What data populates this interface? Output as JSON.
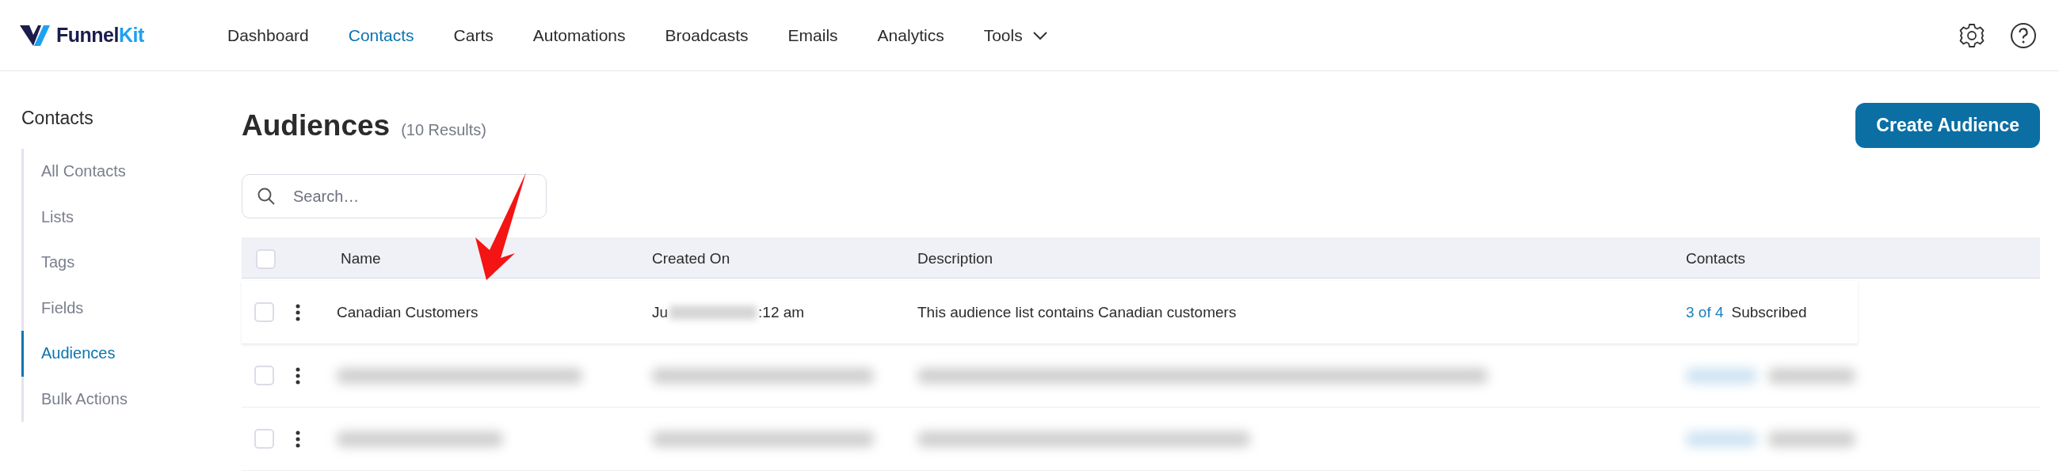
{
  "logo": {
    "parts": [
      "Funnel",
      "Kit"
    ]
  },
  "nav": [
    {
      "label": "Dashboard",
      "selected": false
    },
    {
      "label": "Contacts",
      "selected": true
    },
    {
      "label": "Carts",
      "selected": false
    },
    {
      "label": "Automations",
      "selected": false
    },
    {
      "label": "Broadcasts",
      "selected": false
    },
    {
      "label": "Emails",
      "selected": false
    },
    {
      "label": "Analytics",
      "selected": false
    },
    {
      "label": "Tools",
      "selected": false,
      "kind": "dropdown"
    }
  ],
  "sidebar": {
    "title": "Contacts",
    "items": [
      {
        "label": "All Contacts",
        "selected": false
      },
      {
        "label": "Lists",
        "selected": false
      },
      {
        "label": "Tags",
        "selected": false
      },
      {
        "label": "Fields",
        "selected": false
      },
      {
        "label": "Audiences",
        "selected": true
      },
      {
        "label": "Bulk Actions",
        "selected": false
      }
    ]
  },
  "page": {
    "title": "Audiences",
    "count": "(10 Results)",
    "create_button": "Create Audience"
  },
  "search": {
    "placeholder": "Search…"
  },
  "table": {
    "select_all_checked": false,
    "columns": [
      "Name",
      "Created On",
      "Description",
      "Contacts"
    ],
    "rows": [
      {
        "kind": "visible",
        "checked": false,
        "name": "Canadian Customers",
        "created_on": {
          "start": "Ju",
          "end": ":12 am"
        },
        "description": "This audience list contains Canadian customers",
        "contacts_count": "3 of 4",
        "contacts_status": "Subscribed"
      },
      {
        "kind": "redacted",
        "checked": false
      },
      {
        "kind": "redacted",
        "checked": false
      }
    ]
  }
}
